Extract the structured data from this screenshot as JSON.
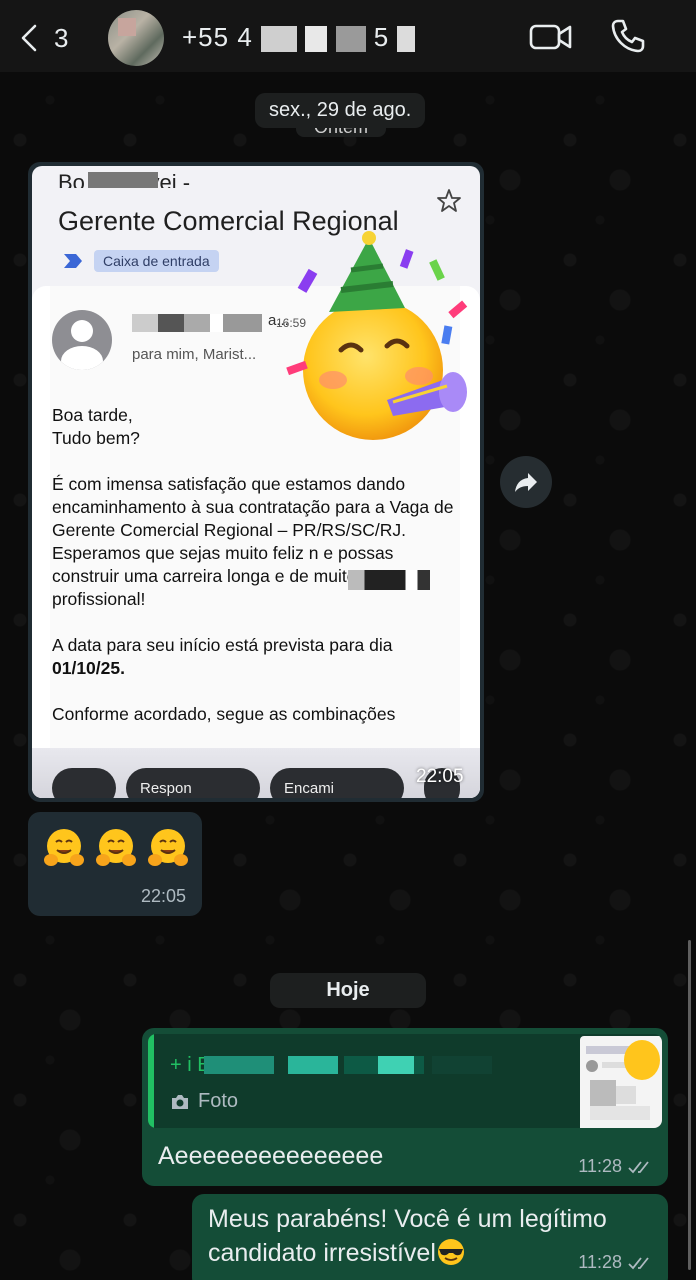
{
  "header": {
    "back_count": "3",
    "contact_name": "+55 4",
    "contact_name_suffix": "5"
  },
  "date_separators": {
    "older": "sex., 29 de ago.",
    "older_behind": "Ontem",
    "today": "Hoje"
  },
  "incoming": {
    "image_message": {
      "time": "22:05",
      "email": {
        "sender_top": "Bo        de Olivei   -",
        "subject": "Gerente Comercial Regional",
        "label": "Caixa de entrada",
        "from_suffix": "a...",
        "time": "16:59",
        "to": "para mim, Marist...",
        "body_line1": "Boa tarde,           \nTudo bem?\n\nÉ com imensa satisfação que estamos dando encaminhamento à sua contratação para a Vaga de Gerente Comercial Regional – PR/RS/SC/RJ.\nEsperamos que sejas muito feliz n          e possas construir uma carreira longa e de muito sucesso profissional!\n\nA data para seu início está prevista para dia ",
        "body_date": "01/10/25.",
        "body_line3": "\n\nConforme acordado, segue as combinações",
        "actions": [
          "Respon",
          "Encami"
        ]
      }
    },
    "emoji_message": {
      "emojis": [
        "hugging-face",
        "hugging-face",
        "hugging-face"
      ],
      "time": "22:05"
    }
  },
  "outgoing": [
    {
      "quote_author": "+           i B...",
      "quote_type": "Foto",
      "text": "Aeeeeeeeeeeeeeee",
      "time": "11:28",
      "status": "read"
    },
    {
      "text": "Meus parabéns! Você é um legítimo candidato irresistível",
      "emoji": "smiling-face-with-sunglasses",
      "time": "11:28",
      "status": "read"
    }
  ],
  "colors": {
    "header_bg": "#151515",
    "incoming_bubble": "#202c33",
    "outgoing_bubble": "#144d37",
    "accent_green": "#21c063"
  }
}
